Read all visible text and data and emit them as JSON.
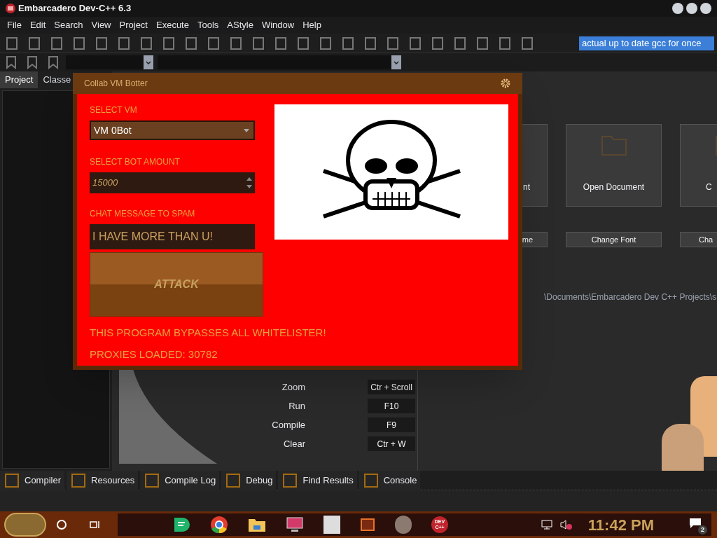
{
  "window": {
    "title": "Embarcadero Dev-C++ 6.3"
  },
  "menu": [
    "File",
    "Edit",
    "Search",
    "View",
    "Project",
    "Execute",
    "Tools",
    "AStyle",
    "Window",
    "Help"
  ],
  "toolbar": {
    "comment_field": {
      "value": "actual up to date gcc for once"
    }
  },
  "left_panel": {
    "tabs": [
      {
        "label": "Project",
        "selected": true
      },
      {
        "label": "Classe",
        "selected": false
      }
    ]
  },
  "welcome": {
    "cards": [
      "nt",
      "Open Document",
      "C"
    ],
    "buttons": [
      "me",
      "Change Font",
      "Cha"
    ],
    "path": "\\Documents\\Embarcadero Dev C++ Projects\\s",
    "shortcuts": [
      {
        "action": "Zoom",
        "keys": "Ctr + Scroll"
      },
      {
        "action": "Run",
        "keys": "F10"
      },
      {
        "action": "Compile",
        "keys": "F9"
      },
      {
        "action": "Clear",
        "keys": "Ctr + W"
      }
    ]
  },
  "dialog": {
    "title": "Collab VM Botter",
    "fields": [
      {
        "kind": "dropdown",
        "label": "SELECT VM",
        "value": "VM 0Bot"
      },
      {
        "kind": "spinner",
        "label": "SELECT BOT AMOUNT",
        "value": "15000"
      },
      {
        "kind": "text",
        "label": "CHAT MESSAGE TO SPAM",
        "value": "I HAVE MORE THAN U!"
      }
    ],
    "button": "ATTACK",
    "messages": [
      "THIS PROGRAM BYPASSES ALL WHITELISTER!",
      "PROXIES LOADED: 30782"
    ]
  },
  "bottom_tabs": [
    "Compiler",
    "Resources",
    "Compile Log",
    "Debug",
    "Find Results",
    "Console"
  ],
  "taskbar": {
    "app_badge": "DEV C++",
    "time": "11:42 PM",
    "notification_count": "2"
  }
}
